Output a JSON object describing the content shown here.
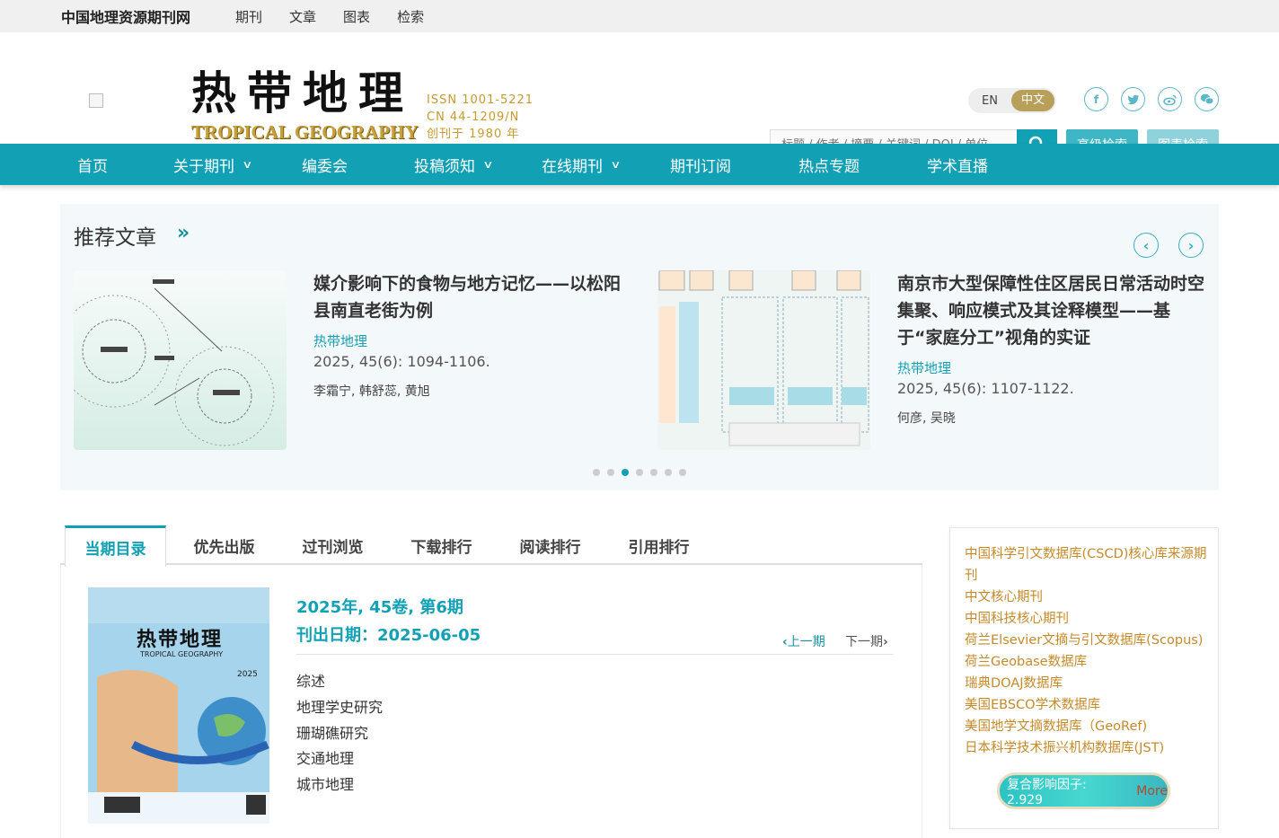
{
  "topbar": {
    "site": "中国地理资源期刊网",
    "links": [
      "期刊",
      "文章",
      "图表",
      "检索"
    ]
  },
  "header": {
    "logo_cn": "热带地理",
    "logo_en": "TROPICAL GEOGRAPHY",
    "issn": "ISSN 1001-5221",
    "cn": "CN 44-1209/N",
    "founded": "创刊于 1980 年",
    "lang_en": "EN",
    "lang_zh": "中文",
    "search_placeholder": "标题 / 作者 / 摘要 / 关键词 / DOI / 单位",
    "advanced_search": "高级检索",
    "figure_search": "图表检索",
    "social_icons": [
      "facebook-icon",
      "twitter-icon",
      "weibo-icon",
      "wechat-icon"
    ]
  },
  "nav": [
    "首页",
    "关于期刊",
    "编委会",
    "投稿须知",
    "在线期刊",
    "期刊订阅",
    "热点专题",
    "学术直播"
  ],
  "recommended": {
    "title": "推荐文章",
    "more": "»",
    "cards": [
      {
        "title": "媒介影响下的食物与地方记忆——以松阳县南直老街为例",
        "journal": "热带地理",
        "volume": "2025, 45(6): 1094-1106.",
        "authors": "李霜宁, 韩舒蕊, 黄旭"
      },
      {
        "title": "南京市大型保障性住区居民日常活动时空集聚、响应模式及其诠释模型——基于“家庭分工”视角的实证",
        "journal": "热带地理",
        "volume": "2025, 45(6): 1107-1122.",
        "authors": "何彦, 吴晓"
      }
    ]
  },
  "tabs": [
    "当期目录",
    "优先出版",
    "过刊浏览",
    "下载排行",
    "阅读排行",
    "引用排行"
  ],
  "issue": {
    "title": "2025年, 45卷, 第6期",
    "date": "刊出日期：2025-06-05",
    "prev": "上一期",
    "next": "下一期",
    "sections": [
      "综述",
      "地理学史研究",
      "珊瑚礁研究",
      "交通地理",
      "城市地理"
    ],
    "cover_title": "热带地理",
    "cover_en": "TROPICAL GEOGRAPHY",
    "cover_year": "2025"
  },
  "databases": [
    "中国科学引文数据库(CSCD)核心库来源期刊",
    "中文核心期刊",
    "中国科技核心期刊",
    "荷兰Elsevier文摘与引文数据库(Scopus)",
    "荷兰Geobase数据库",
    "瑞典DOAJ数据库",
    "美国EBSCO学术数据库",
    "美国地学文摘数据库（GeoRef)",
    "日本科学技术振兴机构数据库(JST)"
  ],
  "impact": {
    "label": "复合影响因子: 2.929",
    "more": "More"
  },
  "colors": {
    "primary": "#12a0b4",
    "gold": "#c58a2a"
  }
}
